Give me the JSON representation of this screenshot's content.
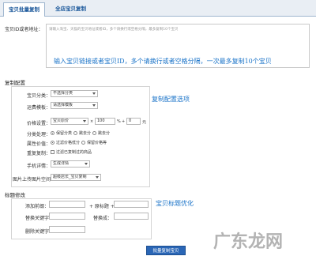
{
  "tabs": [
    {
      "label": "宝贝批量复制"
    },
    {
      "label": "全店宝贝复制"
    }
  ],
  "url_input": {
    "label": "宝贝ID或者地址：",
    "placeholder": "请输入淘宝、天猫的宝贝地址或者ID，多个请换行或空格分隔，最多复制10个宝贝"
  },
  "notes": {
    "url_hint": "输入宝贝链接或者宝贝ID，多个请换行或者空格分隔，一次最多复制10个宝贝",
    "config_hint": "复制配置选项",
    "title_hint": "宝贝标题优化"
  },
  "copy_config": {
    "title": "复制配置",
    "category": {
      "label": "宝贝分类：",
      "value": "不选择分类"
    },
    "shipping": {
      "label": "运费模板：",
      "value": "请选择模板"
    },
    "price": {
      "label": "价格设置：",
      "base": "宝贝原价",
      "operator": "×",
      "percent": "100",
      "percent_unit": "%",
      "plus": "+",
      "add": "0",
      "unit": "元"
    },
    "category_handling": {
      "label": "分类处理：",
      "options": [
        "保留分类",
        "跳去分",
        "跳去分"
      ]
    },
    "attr_value": {
      "label": "属性价值：",
      "options": [
        "过滤价格低分",
        "保留价格等"
      ]
    },
    "filter": {
      "label": "重复复制：",
      "option": "过滤已复制过的商品"
    },
    "mobile_detail": {
      "label": "手机详情：",
      "value": "生成详情"
    },
    "image_space": {
      "label": "图片上传图片空间：",
      "value": "超级店长_宝贝复制"
    }
  },
  "title_edit": {
    "title": "标题修改",
    "prefix_label": "添加前缀：",
    "suffix_label": "+ 原标题 +",
    "replace_label": "替换关键字：",
    "replace_with": "替换成：",
    "delete_label": "删除关键字："
  },
  "submit": {
    "label": "批量复制宝贝"
  },
  "watermark": "广东龙网"
}
